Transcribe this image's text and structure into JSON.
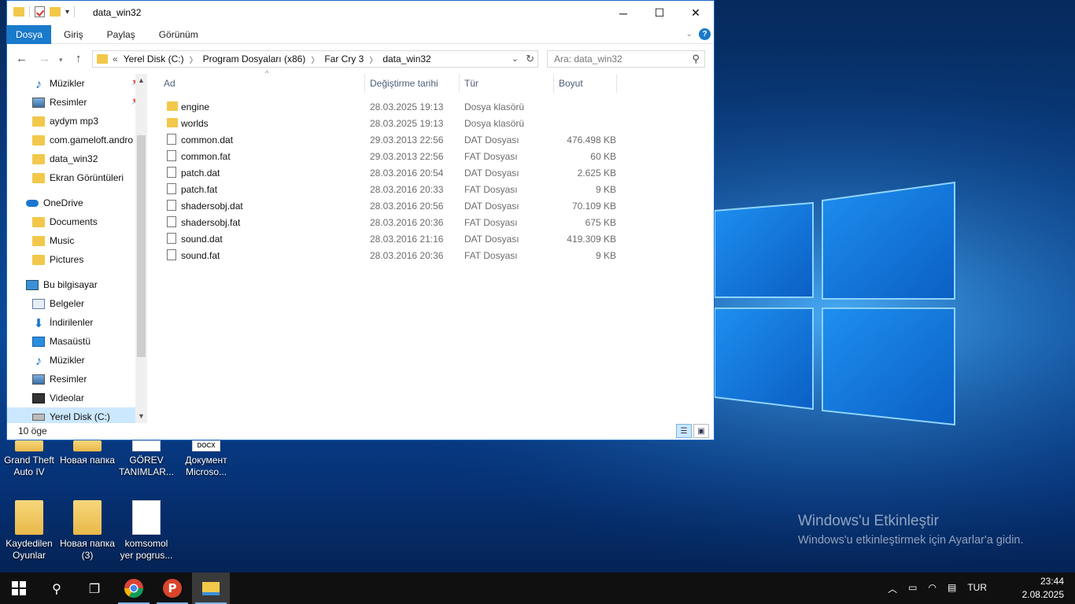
{
  "window": {
    "title": "data_win32",
    "minimize_glyph": "─",
    "maximize_glyph": "☐",
    "close_glyph": "✕"
  },
  "ribbon": {
    "tabs": [
      "Dosya",
      "Giriş",
      "Paylaş",
      "Görünüm"
    ],
    "help_glyph": "?"
  },
  "address": {
    "overflow": "«",
    "crumbs": [
      "Yerel Disk (C:)",
      "Program Dosyaları (x86)",
      "Far Cry 3",
      "data_win32"
    ],
    "search_placeholder": "Ara: data_win32"
  },
  "nav": {
    "items": [
      {
        "label": "Müzikler",
        "icon": "music-icon",
        "pinned": true
      },
      {
        "label": "Resimler",
        "icon": "pictures-icon",
        "pinned": true
      },
      {
        "label": "aydym mp3",
        "icon": "folder-icon"
      },
      {
        "label": "com.gameloft.andro",
        "icon": "folder-icon"
      },
      {
        "label": "data_win32",
        "icon": "folder-icon"
      },
      {
        "label": "Ekran Görüntüleri",
        "icon": "folder-icon"
      },
      {
        "label": "OneDrive",
        "icon": "onedrive-icon"
      },
      {
        "label": "Documents",
        "icon": "folder-icon"
      },
      {
        "label": "Music",
        "icon": "folder-icon"
      },
      {
        "label": "Pictures",
        "icon": "folder-icon"
      },
      {
        "label": "Bu bilgisayar",
        "icon": "computer-icon"
      },
      {
        "label": "Belgeler",
        "icon": "documents-icon"
      },
      {
        "label": "İndirilenler",
        "icon": "download-icon"
      },
      {
        "label": "Masaüstü",
        "icon": "desktop-icon"
      },
      {
        "label": "Müzikler",
        "icon": "music-icon"
      },
      {
        "label": "Resimler",
        "icon": "pictures-icon"
      },
      {
        "label": "Videolar",
        "icon": "videos-icon"
      },
      {
        "label": "Yerel Disk (C:)",
        "icon": "drive-icon",
        "selected": true
      }
    ]
  },
  "columns": {
    "name": "Ad",
    "date": "Değiştirme tarihi",
    "type": "Tür",
    "size": "Boyut"
  },
  "files": [
    {
      "name": "engine",
      "date": "28.03.2025 19:13",
      "type": "Dosya klasörü",
      "size": "",
      "kind": "folder"
    },
    {
      "name": "worlds",
      "date": "28.03.2025 19:13",
      "type": "Dosya klasörü",
      "size": "",
      "kind": "folder"
    },
    {
      "name": "common.dat",
      "date": "29.03.2013 22:56",
      "type": "DAT Dosyası",
      "size": "476.498 KB",
      "kind": "file"
    },
    {
      "name": "common.fat",
      "date": "29.03.2013 22:56",
      "type": "FAT Dosyası",
      "size": "60 KB",
      "kind": "file"
    },
    {
      "name": "patch.dat",
      "date": "28.03.2016 20:54",
      "type": "DAT Dosyası",
      "size": "2.625 KB",
      "kind": "file"
    },
    {
      "name": "patch.fat",
      "date": "28.03.2016 20:33",
      "type": "FAT Dosyası",
      "size": "9 KB",
      "kind": "file"
    },
    {
      "name": "shadersobj.dat",
      "date": "28.03.2016 20:56",
      "type": "DAT Dosyası",
      "size": "70.109 KB",
      "kind": "file"
    },
    {
      "name": "shadersobj.fat",
      "date": "28.03.2016 20:36",
      "type": "FAT Dosyası",
      "size": "675 KB",
      "kind": "file"
    },
    {
      "name": "sound.dat",
      "date": "28.03.2016 21:16",
      "type": "DAT Dosyası",
      "size": "419.309 KB",
      "kind": "file"
    },
    {
      "name": "sound.fat",
      "date": "28.03.2016 20:36",
      "type": "FAT Dosyası",
      "size": "9 KB",
      "kind": "file"
    }
  ],
  "status": {
    "count": "10 öge"
  },
  "desktop_icons": [
    {
      "label": "Grand Theft Auto IV",
      "kind": "folder"
    },
    {
      "label": "Новая папка",
      "kind": "folder"
    },
    {
      "label": "GÖREV TANIMLAR...",
      "kind": "doc"
    },
    {
      "label": "Документ Microso...",
      "kind": "docx",
      "badge": "DOCX"
    },
    {
      "label": "Kaydedilen Oyunlar",
      "kind": "folder"
    },
    {
      "label": "Новая папка (3)",
      "kind": "folder"
    },
    {
      "label": "komsomol yer pogrus...",
      "kind": "doc"
    }
  ],
  "activation": {
    "title": "Windows'u Etkinleştir",
    "subtitle": "Windows'u etkinleştirmek için Ayarlar'a gidin."
  },
  "taskbar": {
    "language": "TUR",
    "time": "23:44",
    "date": "2.08.2025",
    "apps": [
      "search-icon",
      "task-view-icon",
      "chrome-icon",
      "psiphon-icon",
      "file-explorer-icon"
    ]
  },
  "colors": {
    "accent": "#1979ca",
    "selection": "#cce8ff",
    "folder": "#f2c84b"
  }
}
